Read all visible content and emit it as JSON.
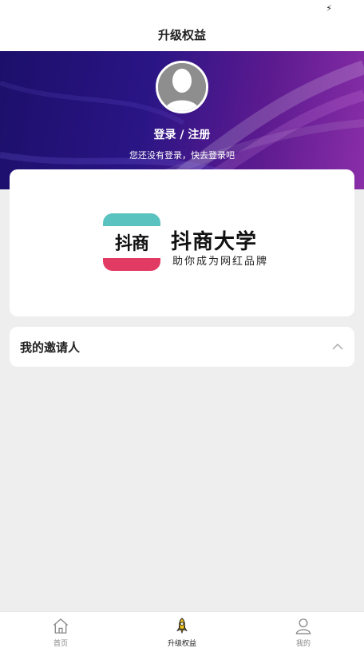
{
  "status_bar": {
    "icon": "bolt-icon"
  },
  "header": {
    "title": "升级权益"
  },
  "profile": {
    "login_label": "登录 / 注册",
    "hint": "您还没有登录，快去登录吧"
  },
  "banner": {
    "logo_text": "抖商",
    "brand_name": "抖商大学",
    "slogan": "助你成为网红品牌",
    "colors": {
      "teal": "#5bc3bf",
      "red": "#e23b63"
    }
  },
  "inviter": {
    "title": "我的邀请人",
    "icon": "chevron-up-icon"
  },
  "tabs": [
    {
      "label": "首页",
      "icon": "home-icon",
      "active": false
    },
    {
      "label": "升级权益",
      "icon": "rocket-icon",
      "active": true
    },
    {
      "label": "我的",
      "icon": "user-icon",
      "active": false
    }
  ],
  "colors": {
    "accent": "#f5c518",
    "hero_start": "#1c0f6a",
    "hero_end": "#8a2ea8"
  }
}
